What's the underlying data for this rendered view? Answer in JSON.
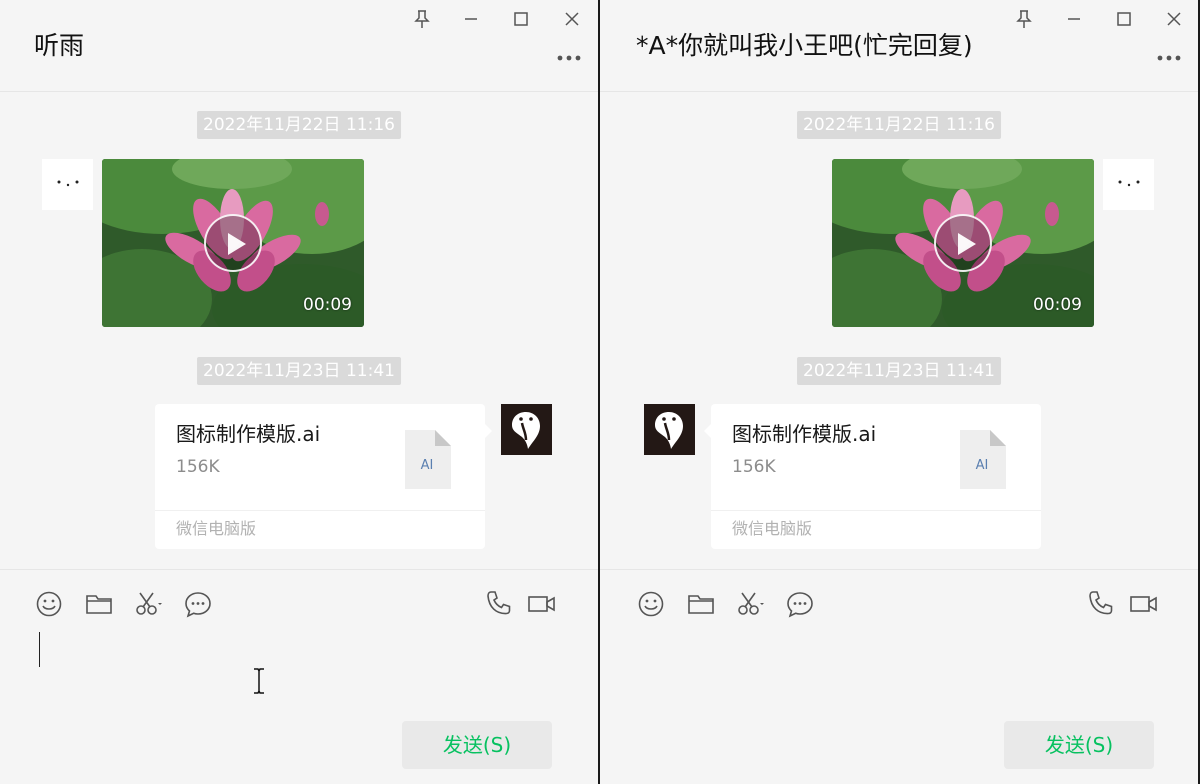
{
  "windows": [
    {
      "title": "听雨",
      "messages": {
        "timestamp_1": "2022年11月22日 11:16",
        "video_duration": "00:09",
        "timestamp_2": "2022年11月23日 11:41",
        "file": {
          "name": "图标制作模版.ai",
          "size": "156K",
          "type_label": "AI",
          "source": "微信电脑版"
        }
      },
      "send_label": "发送(S)"
    },
    {
      "title": "*A*你就叫我小王吧(忙完回复)",
      "messages": {
        "timestamp_1": "2022年11月22日 11:16",
        "video_duration": "00:09",
        "timestamp_2": "2022年11月23日 11:41",
        "file": {
          "name": "图标制作模版.ai",
          "size": "156K",
          "type_label": "AI",
          "source": "微信电脑版"
        }
      },
      "send_label": "发送(S)"
    }
  ],
  "colors": {
    "window_bg": "#f5f5f5",
    "timestamp_bg": "#dadada",
    "send_text": "#07c160",
    "send_bg": "#e9e9e9",
    "bubble_bg": "#ffffff",
    "avatar_dark": "#231815"
  },
  "icons": {
    "title_controls": [
      "pin-icon",
      "minimize-icon",
      "maximize-icon",
      "close-icon"
    ],
    "header": "more-icon",
    "toolbar_left": [
      "emoji-icon",
      "folder-icon",
      "scissors-icon",
      "chat-history-icon"
    ],
    "toolbar_right": [
      "phone-icon",
      "video-call-icon"
    ]
  }
}
